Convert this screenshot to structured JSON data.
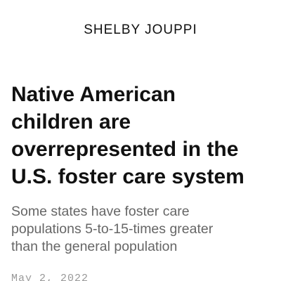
{
  "article": {
    "author": "SHELBY JOUPPI",
    "headline_lines": [
      "Native American",
      "children are",
      "overrepresented in the",
      "U.S. foster care system"
    ],
    "subhead_lines": [
      "Some states have foster care",
      "populations 5-to-15-times greater",
      "than the general population"
    ],
    "date": "May 2, 2022"
  },
  "colors": {
    "text": "#111111",
    "subhead": "#666666",
    "date": "#999999",
    "background": "#ffffff"
  }
}
